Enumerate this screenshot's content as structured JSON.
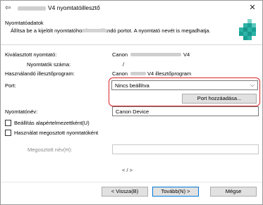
{
  "window": {
    "title": "V4 nyomtatóillesztő",
    "back_glyph": "⇦",
    "close_glyph": "✕"
  },
  "header": {
    "section_title": "Nyomtatóadatok",
    "description": "Állítsa be a kijelölt nyomtatóhoz használandó portot. A nyomtató nevét is megadhatja."
  },
  "info": {
    "selected_printer_label": "Kiválasztott nyomtató:",
    "selected_printer_value": "Canon",
    "selected_printer_suffix": "V4",
    "printer_count_label": "Nyomtatók száma:",
    "printer_count_value": "/",
    "driver_label": "Használandó illesztőprogram:",
    "driver_value_prefix": "Canon",
    "driver_value_suffix": "V4 illesztőprogram"
  },
  "port": {
    "label": "Port:",
    "selected": "Nincs beállítva",
    "add_button": "Port hozzáadása..."
  },
  "printer_name": {
    "label": "Nyomtatónév:",
    "value": "Canon Device"
  },
  "options": {
    "set_default": "Beállítás alapértelmezettként(U)",
    "use_shared": "Használat megosztott nyomtatóként",
    "share_name_label": "Megosztott név(H):"
  },
  "pager": "< / >",
  "footer": {
    "back_button": "< Vissza(B)",
    "next_button": "Tovább(N) >",
    "cancel_button": "Mégse"
  },
  "colors": {
    "highlight_border": "#d9262b",
    "primary_border": "#0078d7",
    "icon_teal": "#2bb3a6"
  }
}
